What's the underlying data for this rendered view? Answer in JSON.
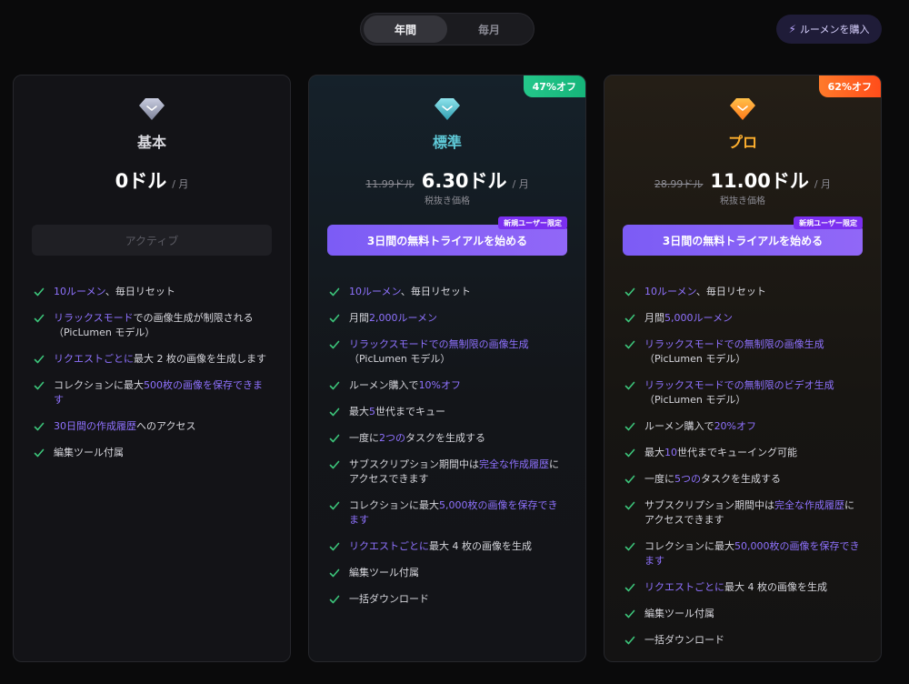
{
  "toggle": {
    "yearly": "年間",
    "monthly": "毎月"
  },
  "buy_button": {
    "icon": "lightning-icon",
    "label": "ルーメンを購入"
  },
  "colors": {
    "accent": "#8f72ff",
    "standard_name": "#5ec8d6",
    "pro_name": "#ffb02e",
    "check": "#3cc47a"
  },
  "plans": [
    {
      "name": "基本",
      "gem_icon": "gray-diamond-icon",
      "price": "0ドル",
      "per": "/ 月",
      "button": "アクティブ",
      "features": [
        [
          {
            "t": "10ルーメン",
            "h": true
          },
          {
            "t": "、毎日リセット"
          }
        ],
        [
          {
            "t": "リラックスモード",
            "h": true
          },
          {
            "t": "での画像生成が制限される（PicLumen モデル）"
          }
        ],
        [
          {
            "t": "リクエストごとに",
            "h": true
          },
          {
            "t": "最大 2 枚の画像を生成します"
          }
        ],
        [
          {
            "t": "コレクションに最大"
          },
          {
            "t": "500枚の画像を保存できます",
            "h": true
          }
        ],
        [
          {
            "t": "30日間の作成履歴",
            "h": true
          },
          {
            "t": "へのアクセス"
          }
        ],
        [
          {
            "t": "編集ツール付属"
          }
        ]
      ]
    },
    {
      "name": "標準",
      "gem_icon": "cyan-diamond-icon",
      "discount": "47%オフ",
      "old_price": "11.99ドル",
      "price": "6.30ドル",
      "per": "/ 月",
      "tax_note": "税抜き価格",
      "badge": "新規ユーザー限定",
      "button": "3日間の無料トライアルを始める",
      "features": [
        [
          {
            "t": "10ルーメン",
            "h": true
          },
          {
            "t": "、毎日リセット"
          }
        ],
        [
          {
            "t": "月間"
          },
          {
            "t": "2,000ルーメン",
            "h": true
          }
        ],
        [
          {
            "t": "リラックスモードでの無制限の画像生成",
            "h": true
          },
          {
            "t": "（PicLumen モデル）"
          }
        ],
        [
          {
            "t": "ルーメン購入で"
          },
          {
            "t": "10%オフ",
            "h": true
          }
        ],
        [
          {
            "t": "最大"
          },
          {
            "t": "5",
            "h": true
          },
          {
            "t": "世代までキュー"
          }
        ],
        [
          {
            "t": "一度に"
          },
          {
            "t": "2つの",
            "h": true
          },
          {
            "t": "タスクを生成する"
          }
        ],
        [
          {
            "t": "サブスクリプション期間中は"
          },
          {
            "t": "完全な作成履歴",
            "h": true
          },
          {
            "t": "にアクセスできます"
          }
        ],
        [
          {
            "t": "コレクションに最大"
          },
          {
            "t": "5,000枚の画像を保存できます",
            "h": true
          }
        ],
        [
          {
            "t": "リクエストごとに",
            "h": true
          },
          {
            "t": "最大 4 枚の画像を生成"
          }
        ],
        [
          {
            "t": "編集ツール付属"
          }
        ],
        [
          {
            "t": "一括ダウンロード"
          }
        ]
      ]
    },
    {
      "name": "プロ",
      "gem_icon": "orange-diamond-icon",
      "discount": "62%オフ",
      "old_price": "28.99ドル",
      "price": "11.00ドル",
      "per": "/ 月",
      "tax_note": "税抜き価格",
      "badge": "新規ユーザー限定",
      "button": "3日間の無料トライアルを始める",
      "features": [
        [
          {
            "t": "10ルーメン",
            "h": true
          },
          {
            "t": "、毎日リセット"
          }
        ],
        [
          {
            "t": "月間"
          },
          {
            "t": "5,000ルーメン",
            "h": true
          }
        ],
        [
          {
            "t": "リラックスモードでの無制限の画像生成",
            "h": true
          },
          {
            "t": "（PicLumen モデル）"
          }
        ],
        [
          {
            "t": "リラックスモードでの無制限のビデオ生成",
            "h": true
          },
          {
            "t": "（PicLumen モデル）"
          }
        ],
        [
          {
            "t": "ルーメン購入で"
          },
          {
            "t": "20%オフ",
            "h": true
          }
        ],
        [
          {
            "t": "最大"
          },
          {
            "t": "10",
            "h": true
          },
          {
            "t": "世代までキューイング可能"
          }
        ],
        [
          {
            "t": "一度に"
          },
          {
            "t": "5つの",
            "h": true
          },
          {
            "t": "タスクを生成する"
          }
        ],
        [
          {
            "t": "サブスクリプション期間中は"
          },
          {
            "t": "完全な作成履歴",
            "h": true
          },
          {
            "t": "にアクセスできます"
          }
        ],
        [
          {
            "t": "コレクションに最大"
          },
          {
            "t": "50,000枚の画像を保存できます",
            "h": true
          }
        ],
        [
          {
            "t": "リクエストごとに",
            "h": true
          },
          {
            "t": "最大 4 枚の画像を生成"
          }
        ],
        [
          {
            "t": "編集ツール付属"
          }
        ],
        [
          {
            "t": "一括ダウンロード"
          }
        ]
      ]
    }
  ]
}
